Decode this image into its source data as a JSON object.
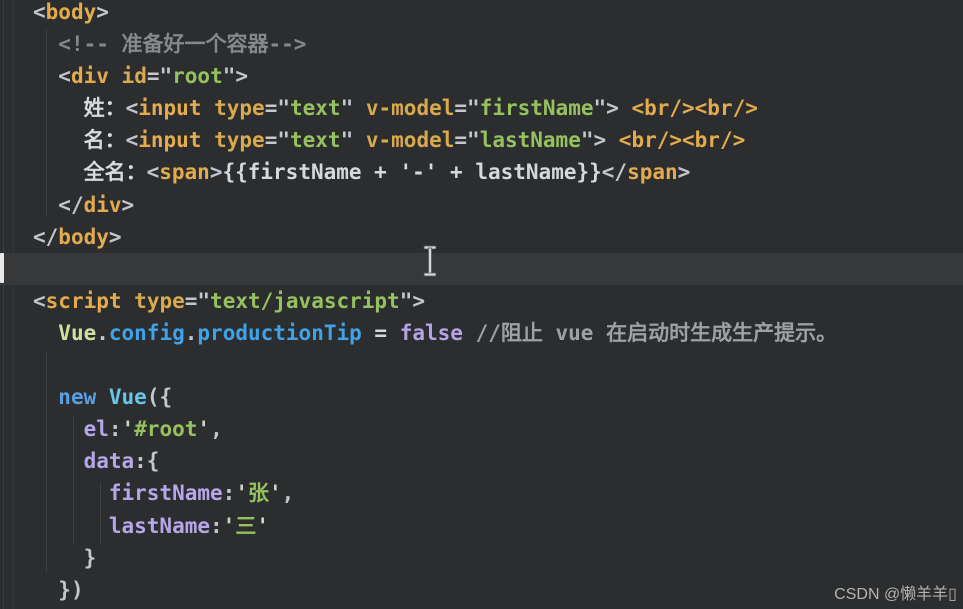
{
  "palette": {
    "bg": "#2c2d2e",
    "band": "#36383a",
    "plain": "#d6d8da",
    "punct": "#c3c7cc",
    "tag": "#e3ab4d",
    "attr": "#d8a94e",
    "str": "#95c25e",
    "q": "#ccd4c2",
    "text": "#d9dadb",
    "cmt": "#84898c",
    "cmt2": "#9ba1a4",
    "cls": "#cfe2a2",
    "prop": "#3ea3e8",
    "kw": "#5a9fe0",
    "cls2": "#67c6ea",
    "kw2": "#b6a4e7",
    "key": "#b7a6e8",
    "caret": "#e9e9e9",
    "watermark": "#b3b3b3"
  },
  "editor": {
    "watermark": "CSDN @懒羊羊▯",
    "current_line_index": 8,
    "code_lines": [
      {
        "tokens": [
          [
            "punct",
            "<"
          ],
          [
            "tag",
            "body"
          ],
          [
            "punct",
            ">"
          ]
        ]
      },
      {
        "tokens": [
          [
            "plain",
            "  "
          ],
          [
            "cmt",
            "<!-- 准备好一个容器-->"
          ]
        ]
      },
      {
        "tokens": [
          [
            "plain",
            "  "
          ],
          [
            "punct",
            "<"
          ],
          [
            "tag",
            "div"
          ],
          [
            "plain",
            " "
          ],
          [
            "attr",
            "id"
          ],
          [
            "punct",
            "=\""
          ],
          [
            "str",
            "root"
          ],
          [
            "punct",
            "\">"
          ]
        ]
      },
      {
        "tokens": [
          [
            "plain",
            "    "
          ],
          [
            "text",
            "姓："
          ],
          [
            "punct",
            "<"
          ],
          [
            "tag",
            "input"
          ],
          [
            "plain",
            " "
          ],
          [
            "attr",
            "type"
          ],
          [
            "punct",
            "=\""
          ],
          [
            "str",
            "text"
          ],
          [
            "punct",
            "\""
          ],
          [
            "plain",
            " "
          ],
          [
            "attr",
            "v-model"
          ],
          [
            "punct",
            "=\""
          ],
          [
            "str",
            "firstName"
          ],
          [
            "punct",
            "\">"
          ],
          [
            "plain",
            " "
          ],
          [
            "tagfull",
            "<br/><br/>"
          ]
        ]
      },
      {
        "tokens": [
          [
            "plain",
            "    "
          ],
          [
            "text",
            "名："
          ],
          [
            "punct",
            "<"
          ],
          [
            "tag",
            "input"
          ],
          [
            "plain",
            " "
          ],
          [
            "attr",
            "type"
          ],
          [
            "punct",
            "=\""
          ],
          [
            "str",
            "text"
          ],
          [
            "punct",
            "\""
          ],
          [
            "plain",
            " "
          ],
          [
            "attr",
            "v-model"
          ],
          [
            "punct",
            "=\""
          ],
          [
            "str",
            "lastName"
          ],
          [
            "punct",
            "\">"
          ],
          [
            "plain",
            " "
          ],
          [
            "tagfull",
            "<br/><br/>"
          ]
        ]
      },
      {
        "tokens": [
          [
            "plain",
            "    "
          ],
          [
            "text",
            "全名："
          ],
          [
            "punct",
            "<"
          ],
          [
            "tag",
            "span"
          ],
          [
            "punct",
            ">"
          ],
          [
            "plain",
            "{{firstName + '-' + lastName}}"
          ],
          [
            "punct",
            "</"
          ],
          [
            "tag",
            "span"
          ],
          [
            "punct",
            ">"
          ]
        ]
      },
      {
        "tokens": [
          [
            "plain",
            "  "
          ],
          [
            "punct",
            "</"
          ],
          [
            "tag",
            "div"
          ],
          [
            "punct",
            ">"
          ]
        ]
      },
      {
        "tokens": [
          [
            "punct",
            "</"
          ],
          [
            "tag",
            "body"
          ],
          [
            "punct",
            ">"
          ]
        ]
      },
      {
        "tokens": []
      },
      {
        "tokens": [
          [
            "punct",
            "<"
          ],
          [
            "tag",
            "script"
          ],
          [
            "plain",
            " "
          ],
          [
            "attr",
            "type"
          ],
          [
            "punct",
            "=\""
          ],
          [
            "str",
            "text/javascript"
          ],
          [
            "punct",
            "\">"
          ]
        ]
      },
      {
        "tokens": [
          [
            "plain",
            "  "
          ],
          [
            "cls",
            "Vue"
          ],
          [
            "punct",
            "."
          ],
          [
            "prop",
            "config"
          ],
          [
            "punct",
            "."
          ],
          [
            "prop",
            "productionTip"
          ],
          [
            "plain",
            " = "
          ],
          [
            "kw2",
            "false"
          ],
          [
            "plain",
            " "
          ],
          [
            "cmt2",
            "//阻止 vue 在启动时生成生产提示。"
          ]
        ]
      },
      {
        "tokens": []
      },
      {
        "tokens": [
          [
            "plain",
            "  "
          ],
          [
            "kw",
            "new"
          ],
          [
            "plain",
            " "
          ],
          [
            "cls2",
            "Vue"
          ],
          [
            "punct",
            "({"
          ]
        ]
      },
      {
        "tokens": [
          [
            "plain",
            "    "
          ],
          [
            "key",
            "el"
          ],
          [
            "punct",
            ":"
          ],
          [
            "q",
            "'"
          ],
          [
            "str",
            "#root"
          ],
          [
            "q",
            "'"
          ],
          [
            "punct",
            ","
          ]
        ]
      },
      {
        "tokens": [
          [
            "plain",
            "    "
          ],
          [
            "key",
            "data"
          ],
          [
            "punct",
            ":{"
          ]
        ]
      },
      {
        "tokens": [
          [
            "plain",
            "      "
          ],
          [
            "key",
            "firstName"
          ],
          [
            "punct",
            ":"
          ],
          [
            "q",
            "'"
          ],
          [
            "str",
            "张"
          ],
          [
            "q",
            "'"
          ],
          [
            "punct",
            ","
          ]
        ]
      },
      {
        "tokens": [
          [
            "plain",
            "      "
          ],
          [
            "key",
            "lastName"
          ],
          [
            "punct",
            ":"
          ],
          [
            "q",
            "'"
          ],
          [
            "str",
            "三"
          ],
          [
            "q",
            "'"
          ]
        ]
      },
      {
        "tokens": [
          [
            "plain",
            "    "
          ],
          [
            "punct",
            "}"
          ]
        ]
      },
      {
        "tokens": [
          [
            "plain",
            "  "
          ],
          [
            "punct",
            "})"
          ]
        ]
      }
    ]
  }
}
